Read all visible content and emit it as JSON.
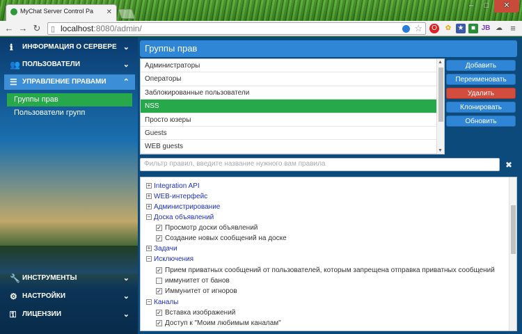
{
  "window": {
    "tab_title": "MyChat Server Control Pa",
    "controls": [
      "–",
      "□",
      "✕"
    ]
  },
  "browser": {
    "url_host": "localhost",
    "url_rest": ":8080/admin/",
    "back_icon": "arrow-left-icon",
    "forward_icon": "arrow-right-icon",
    "reload_icon": "reload-icon"
  },
  "sidebar": {
    "items": [
      {
        "label": "ИНФОРМАЦИЯ О СЕРВЕРЕ",
        "icon": "info-icon"
      },
      {
        "label": "ПОЛЬЗОВАТЕЛИ",
        "icon": "users-icon"
      },
      {
        "label": "УПРАВЛЕНИЕ ПРАВАМИ",
        "icon": "list-icon"
      }
    ],
    "subitems": [
      {
        "label": "Группы прав"
      },
      {
        "label": "Пользователи групп"
      }
    ],
    "bottom_items": [
      {
        "label": "ИНСТРУМЕНТЫ",
        "icon": "wrench-icon"
      },
      {
        "label": "НАСТРОЙКИ",
        "icon": "gears-icon"
      },
      {
        "label": "ЛИЦЕНЗИИ",
        "icon": "key-icon"
      }
    ]
  },
  "header": {
    "title": "Группы прав"
  },
  "groups": [
    {
      "label": "Администраторы"
    },
    {
      "label": "Операторы"
    },
    {
      "label": "Заблокированные пользователи"
    },
    {
      "label": "NSS"
    },
    {
      "label": "Просто юзеры"
    },
    {
      "label": "Guests"
    },
    {
      "label": "WEB guests"
    }
  ],
  "selected_group": "NSS",
  "buttons": {
    "add": "Добавить",
    "rename": "Переименовать",
    "delete": "Удалить",
    "clone": "Клонировать",
    "refresh": "Обновить"
  },
  "filter": {
    "placeholder": "Фильтр правил, введите название нужного вам правила"
  },
  "tree": [
    {
      "label": "Integration API",
      "expanded": false
    },
    {
      "label": "WEB-интерфейс",
      "expanded": false
    },
    {
      "label": "Администрирование",
      "expanded": false
    },
    {
      "label": "Доска объявлений",
      "expanded": true,
      "children": [
        {
          "label": "Просмотр доски объявлений",
          "checked": true
        },
        {
          "label": "Создание новых сообщений на доске",
          "checked": true
        }
      ]
    },
    {
      "label": "Задачи",
      "expanded": false
    },
    {
      "label": "Исключения",
      "expanded": true,
      "children": [
        {
          "label": "Прием приватных сообщений от пользователей, которым запрещена отправка приватных сообщений",
          "checked": true
        },
        {
          "label": "иммунитет от банов",
          "checked": false
        },
        {
          "label": "Иммунитет от игноров",
          "checked": true
        }
      ]
    },
    {
      "label": "Каналы",
      "expanded": true,
      "children": [
        {
          "label": "Вставка изображений",
          "checked": true
        },
        {
          "label": "Доступ к \"Моим любимым каналам\"",
          "checked": true
        }
      ]
    }
  ],
  "colors": {
    "accent": "#2f86d6",
    "selected": "#27a84a",
    "danger": "#d34d3f"
  }
}
